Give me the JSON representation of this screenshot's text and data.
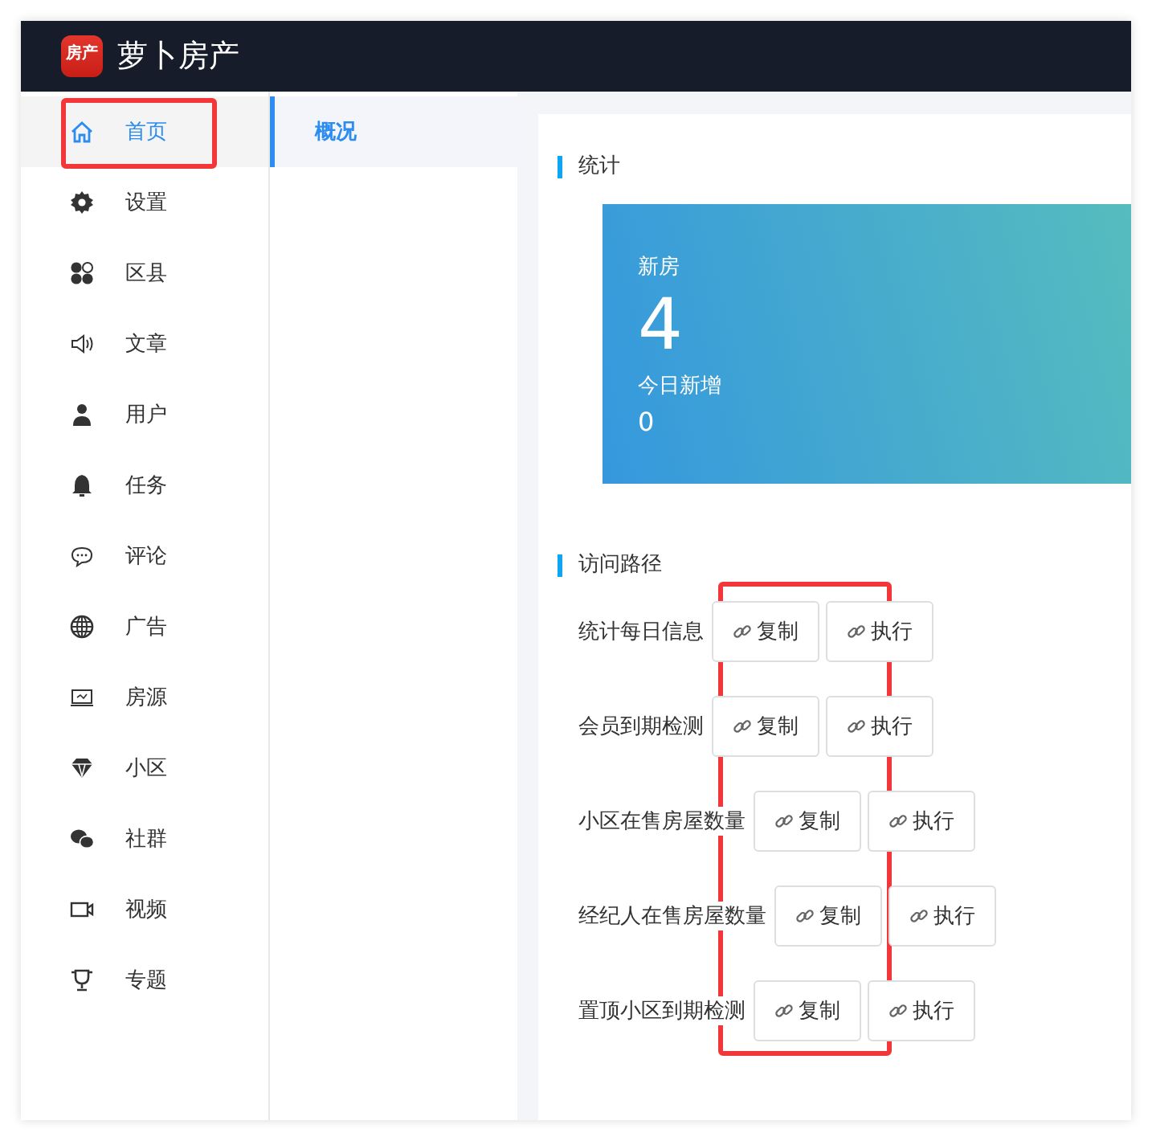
{
  "header": {
    "logo_text": "房产",
    "title": "萝卜房产"
  },
  "sidebar": {
    "items": [
      {
        "label": "首页",
        "selected": true
      },
      {
        "label": "设置",
        "selected": false
      },
      {
        "label": "区县",
        "selected": false
      },
      {
        "label": "文章",
        "selected": false
      },
      {
        "label": "用户",
        "selected": false
      },
      {
        "label": "任务",
        "selected": false
      },
      {
        "label": "评论",
        "selected": false
      },
      {
        "label": "广告",
        "selected": false
      },
      {
        "label": "房源",
        "selected": false
      },
      {
        "label": "小区",
        "selected": false
      },
      {
        "label": "社群",
        "selected": false
      },
      {
        "label": "视频",
        "selected": false
      },
      {
        "label": "专题",
        "selected": false
      }
    ]
  },
  "submenu": {
    "items": [
      {
        "label": "概况",
        "selected": true
      }
    ]
  },
  "stats": {
    "title": "统计",
    "card": {
      "label": "新房",
      "value": "4",
      "sub_label": "今日新增",
      "sub_value": "0"
    }
  },
  "routes": {
    "title": "访问路径",
    "rows": [
      {
        "label": "统计每日信息",
        "buttons": [
          "复制",
          "执行"
        ]
      },
      {
        "label": "会员到期检测",
        "buttons": [
          "复制",
          "执行"
        ]
      },
      {
        "label": "小区在售房屋数量",
        "buttons": [
          "复制",
          "执行"
        ]
      },
      {
        "label": "经纪人在售房屋数量",
        "buttons": [
          "复制",
          "执行"
        ]
      },
      {
        "label": "置顶小区到期检测",
        "buttons": [
          "复制",
          "执行"
        ]
      }
    ]
  }
}
